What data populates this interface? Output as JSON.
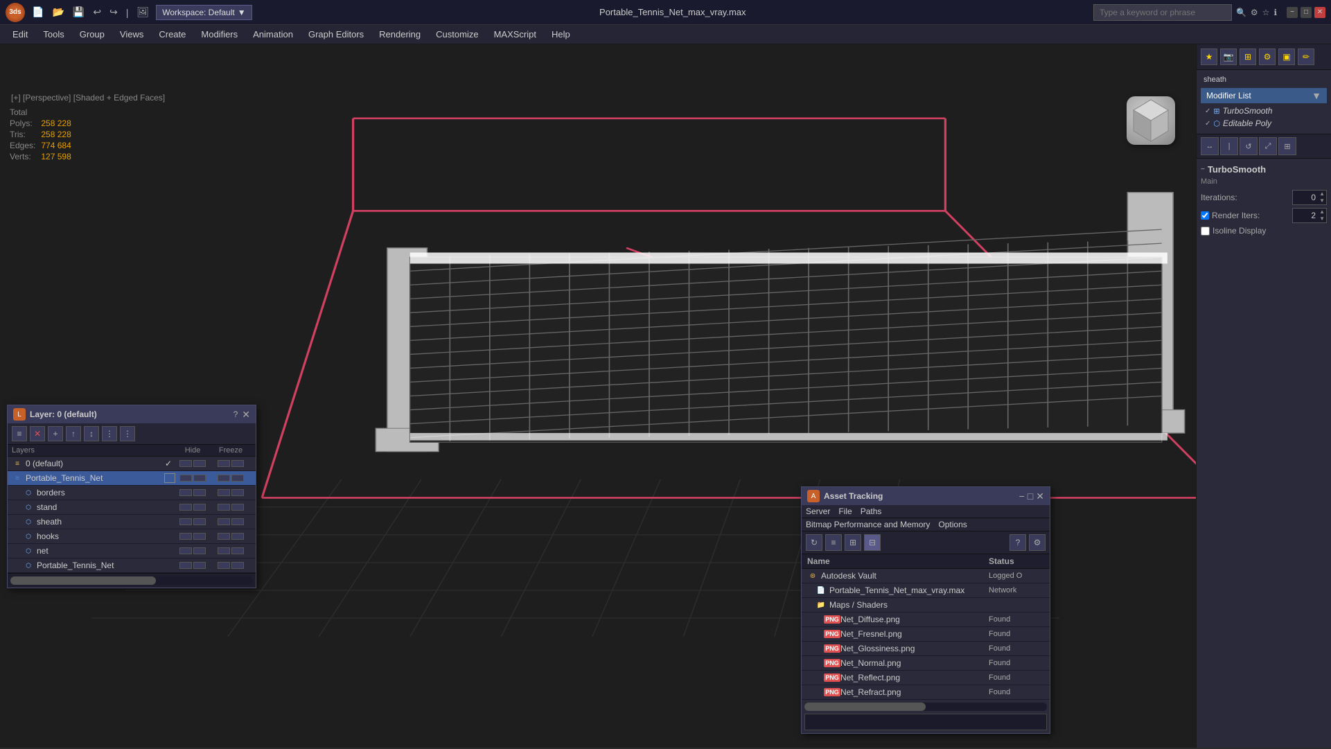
{
  "titlebar": {
    "logo": "3ds",
    "file_title": "Portable_Tennis_Net_max_vray.max",
    "search_placeholder": "Type a keyword or phrase",
    "workspace_label": "Workspace: Default",
    "win_minimize": "−",
    "win_maximize": "□",
    "win_close": "✕"
  },
  "menubar": {
    "items": [
      {
        "label": "Edit"
      },
      {
        "label": "Tools"
      },
      {
        "label": "Group"
      },
      {
        "label": "Views"
      },
      {
        "label": "Create"
      },
      {
        "label": "Modifiers"
      },
      {
        "label": "Animation"
      },
      {
        "label": "Graph Editors"
      },
      {
        "label": "Rendering"
      },
      {
        "label": "Customize"
      },
      {
        "label": "MAXScript"
      },
      {
        "label": "Help"
      }
    ]
  },
  "viewport": {
    "label": "[+] [Perspective] [Shaded + Edged Faces]"
  },
  "stats": {
    "polys_label": "Polys:",
    "polys_value": "258 228",
    "tris_label": "Tris:",
    "tris_value": "258 228",
    "edges_label": "Edges:",
    "edges_value": "774 684",
    "verts_label": "Verts:",
    "verts_value": "127 598",
    "total_label": "Total"
  },
  "right_panel": {
    "sheath_label": "sheath",
    "modifier_list_label": "Modifier List",
    "turbosmooth_label": "TurboSmooth",
    "editable_poly_label": "Editable Poly",
    "ts_section_title": "TurboSmooth",
    "ts_main_label": "Main",
    "iterations_label": "Iterations:",
    "iterations_value": "0",
    "render_iters_label": "Render Iters:",
    "render_iters_value": "2",
    "isoline_label": "Isoline Display"
  },
  "layer_panel": {
    "title": "Layer: 0 (default)",
    "help_label": "?",
    "close_label": "✕",
    "columns": {
      "name": "Layers",
      "hide": "Hide",
      "freeze": "Freeze"
    },
    "rows": [
      {
        "name": "0 (default)",
        "indent": 0,
        "selected": false,
        "checkmark": "✓",
        "icon": "layer"
      },
      {
        "name": "Portable_Tennis_Net",
        "indent": 0,
        "selected": true,
        "checkmark": "",
        "icon": "layer-blue"
      },
      {
        "name": "borders",
        "indent": 1,
        "selected": false,
        "checkmark": "",
        "icon": "obj"
      },
      {
        "name": "stand",
        "indent": 1,
        "selected": false,
        "checkmark": "",
        "icon": "obj"
      },
      {
        "name": "sheath",
        "indent": 1,
        "selected": false,
        "checkmark": "",
        "icon": "obj"
      },
      {
        "name": "hooks",
        "indent": 1,
        "selected": false,
        "checkmark": "",
        "icon": "obj"
      },
      {
        "name": "net",
        "indent": 1,
        "selected": false,
        "checkmark": "",
        "icon": "obj"
      },
      {
        "name": "Portable_Tennis_Net",
        "indent": 1,
        "selected": false,
        "checkmark": "",
        "icon": "obj"
      }
    ]
  },
  "asset_panel": {
    "title": "Asset Tracking",
    "menu_items": [
      "Server",
      "File",
      "Paths"
    ],
    "menu_items2": [
      "Bitmap Performance and Memory",
      "Options"
    ],
    "columns": {
      "name": "Name",
      "status": "Status"
    },
    "rows": [
      {
        "name": "Autodesk Vault",
        "indent": 0,
        "icon": "vault",
        "status": "Logged O",
        "status_class": "loggedc"
      },
      {
        "name": "Portable_Tennis_Net_max_vray.max",
        "indent": 1,
        "icon": "file",
        "status": "Network",
        "status_class": "network"
      },
      {
        "name": "Maps / Shaders",
        "indent": 1,
        "icon": "folder",
        "status": "",
        "status_class": ""
      },
      {
        "name": "Net_Diffuse.png",
        "indent": 2,
        "icon": "png",
        "status": "Found",
        "status_class": "found"
      },
      {
        "name": "Net_Fresnel.png",
        "indent": 2,
        "icon": "png",
        "status": "Found",
        "status_class": "found"
      },
      {
        "name": "Net_Glossiness.png",
        "indent": 2,
        "icon": "png",
        "status": "Found",
        "status_class": "found"
      },
      {
        "name": "Net_Normal.png",
        "indent": 2,
        "icon": "png",
        "status": "Found",
        "status_class": "found"
      },
      {
        "name": "Net_Reflect.png",
        "indent": 2,
        "icon": "png",
        "status": "Found",
        "status_class": "found"
      },
      {
        "name": "Net_Refract.png",
        "indent": 2,
        "icon": "png",
        "status": "Found",
        "status_class": "found"
      }
    ]
  }
}
